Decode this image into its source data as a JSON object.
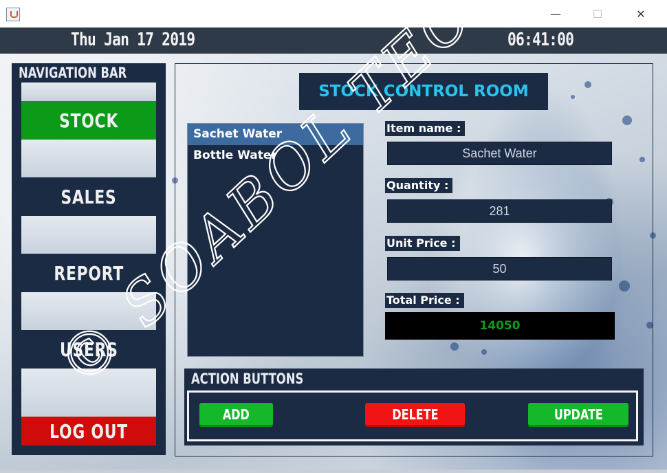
{
  "window": {
    "controls": {
      "minimize": "—",
      "maximize": "☐",
      "close": "✕"
    }
  },
  "header": {
    "date": "Thu Jan 17 2019",
    "time": "06:41:00"
  },
  "nav": {
    "title": "NAVIGATION BAR",
    "items": [
      {
        "label": "STOCK",
        "color": "#0b9b18",
        "active": true
      },
      {
        "label": "SALES"
      },
      {
        "label": "REPORT"
      },
      {
        "label": "USERS"
      },
      {
        "label": "LOG OUT",
        "color": "#cf0b0b"
      }
    ]
  },
  "stock": {
    "title": "STOCK CONTROL ROOM",
    "items": [
      "Sachet Water",
      "Bottle Water"
    ],
    "selected_item": "Sachet Water",
    "fields": {
      "item_name_label": "Item name :",
      "item_name_value": "Sachet Water",
      "quantity_label": "Quantity :",
      "quantity_value": "281",
      "unit_price_label": "Unit Price :",
      "unit_price_value": "50",
      "total_price_label": "Total Price :",
      "total_price_value": "14050"
    }
  },
  "actions": {
    "title": "ACTION BUTTONS",
    "add": "ADD",
    "delete": "DELETE",
    "update": "UPDATE",
    "add_color": "#15b82b",
    "delete_color": "#f21414",
    "update_color": "#15b82b"
  },
  "watermark": {
    "text": "© SOABOL TECH"
  }
}
